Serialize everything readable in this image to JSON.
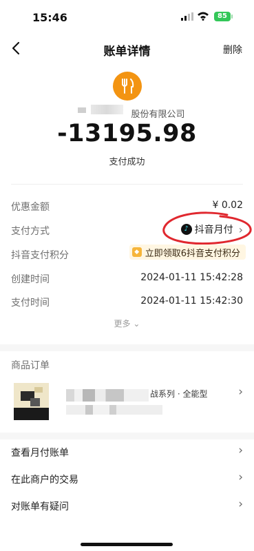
{
  "status_bar": {
    "time": "15:46",
    "battery": "85"
  },
  "nav": {
    "title": "账单详情",
    "delete_label": "删除"
  },
  "summary": {
    "merchant_name": "股份有限公司",
    "amount": "-13195.98",
    "status": "支付成功"
  },
  "details": {
    "discount_label": "优惠金额",
    "discount_value": "¥ 0.02",
    "payment_method_label": "支付方式",
    "payment_method_value": "抖音月付",
    "points_label": "抖音支付积分",
    "points_value": "立即领取6抖音支付积分",
    "created_label": "创建时间",
    "created_value": "2024-01-11 15:42:28",
    "paid_label": "支付时间",
    "paid_value": "2024-01-11 15:42:30",
    "more_label": "更多"
  },
  "order": {
    "header": "商品订单",
    "item_name_visible": "战系列 · 全能型"
  },
  "links": [
    {
      "label": "查看月付账单"
    },
    {
      "label": "在此商户的交易"
    },
    {
      "label": "对账单有疑问"
    }
  ],
  "icons": [
    "back-icon",
    "signal-icon",
    "wifi-icon",
    "battery-icon",
    "fork-knife-icon",
    "tiktok-icon",
    "chevron-right-icon",
    "chevron-down-icon",
    "diamond-icon"
  ],
  "colors": {
    "merchant_icon": "#f39412",
    "battery": "#34c759",
    "annotation": "#e0282f",
    "points_tag_bg": "#fff6e2"
  }
}
